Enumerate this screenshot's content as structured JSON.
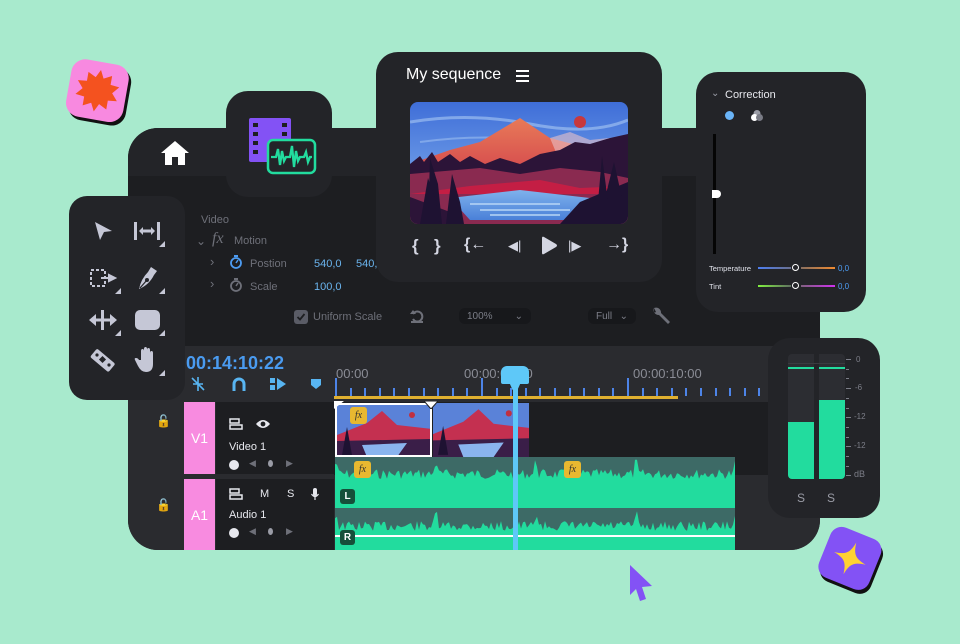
{
  "colors": {
    "background": "#a8eacd",
    "window": "#1d1e21",
    "panel": "#232428",
    "accent_blue": "#5ec8f8",
    "timecode_blue": "#4a9bf0",
    "track_pink": "#f88be0",
    "audio_green": "#22dc9e",
    "fx_yellow": "#e8b830",
    "work_area_yellow": "#e0b030",
    "cursor_purple": "#8352f5"
  },
  "top_bar": {
    "home_icon": "home-icon",
    "media_icon": "media-film-audio-icon"
  },
  "program_monitor": {
    "title": "My sequence",
    "menu_icon": "hamburger-menu-icon",
    "controls": [
      {
        "name": "mark-in",
        "glyph": "{"
      },
      {
        "name": "mark-out",
        "glyph": "}"
      },
      {
        "name": "go-to-in",
        "glyph": "{←"
      },
      {
        "name": "step-back",
        "glyph": "◀|"
      },
      {
        "name": "play",
        "glyph": "▶"
      },
      {
        "name": "step-forward",
        "glyph": "|▶"
      },
      {
        "name": "go-to-out",
        "glyph": "→}"
      }
    ]
  },
  "effect_controls": {
    "section": "Video",
    "effect": "Motion",
    "fx_glyph": "fx",
    "properties": [
      {
        "name": "Postion",
        "values": [
          "540,0",
          "540,"
        ],
        "keyframed": true
      },
      {
        "name": "Scale",
        "values": [
          "100,0"
        ],
        "keyframed": false
      }
    ],
    "uniform_scale": {
      "label": "Uniform Scale",
      "checked": true
    },
    "zoom_select": "100%",
    "quality_select": "Full"
  },
  "correction_panel": {
    "title": "Correction",
    "vertical_slider_value": 0.5,
    "sliders": [
      {
        "label": "Temperature",
        "value": "0,0",
        "position": 0.5
      },
      {
        "label": "Tint",
        "value": "0,0",
        "position": 0.5
      }
    ]
  },
  "tools": [
    {
      "name": "selection-tool",
      "has_menu": false
    },
    {
      "name": "track-select-tool",
      "has_menu": true
    },
    {
      "name": "ripple-edit-tool",
      "has_menu": true
    },
    {
      "name": "pen-tool",
      "has_menu": true
    },
    {
      "name": "slip-tool",
      "has_menu": true
    },
    {
      "name": "rectangle-tool",
      "has_menu": true
    },
    {
      "name": "razor-tool",
      "has_menu": false
    },
    {
      "name": "hand-tool",
      "has_menu": true
    }
  ],
  "timeline": {
    "timecode": "00:14:10:22",
    "ruler_labels": [
      "00:00",
      "00:00:05:00",
      "00:00:10:00"
    ],
    "playhead_seconds": 6.2,
    "tools": [
      "snap-icon",
      "magnet-icon",
      "linked-selection-icon",
      "marker-icon"
    ],
    "tracks": [
      {
        "id": "V1",
        "name": "Video 1",
        "buttons": [
          "toggle-sync",
          "eye"
        ]
      },
      {
        "id": "A1",
        "name": "Audio 1",
        "buttons": [
          "toggle-sync",
          "M",
          "S",
          "mic"
        ]
      }
    ],
    "channels": [
      "L",
      "R"
    ]
  },
  "audio_meter": {
    "scale_labels": [
      "0",
      "-6",
      "-12",
      "-12",
      "dB"
    ],
    "levels": [
      0.46,
      0.63
    ],
    "peak": 0.9,
    "solo_labels": [
      "S",
      "S"
    ]
  }
}
